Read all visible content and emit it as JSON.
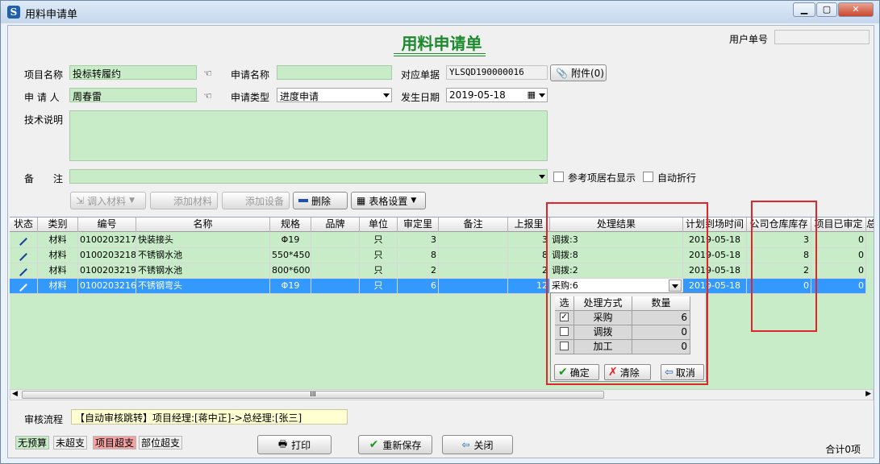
{
  "window": {
    "title": "用料申请单",
    "icon_letter": "S"
  },
  "form": {
    "title": "用料申请单",
    "user_no_label": "用户单号",
    "user_no_value": ""
  },
  "fields": {
    "project_name_label": "项目名称",
    "project_name_value": "投标转履约",
    "request_name_label": "申请名称",
    "request_name_value": "",
    "related_doc_label": "对应单据",
    "related_doc_value": "YLSQD190000016",
    "attachment_label": "附件(0)",
    "applicant_label": "申 请 人",
    "applicant_value": "周春雷",
    "request_type_label": "申请类型",
    "request_type_value": "进度申请",
    "date_label": "发生日期",
    "date_value": "2019-05-18",
    "tech_desc_label": "技术说明",
    "tech_desc_value": "",
    "remark_label": "备　　注",
    "remark_value": "",
    "ref_right_label": "参考项居右显示",
    "auto_wrap_label": "自动折行"
  },
  "toolbar": {
    "import_label": "调入材料",
    "add_material_label": "添加材料",
    "add_equipment_label": "添加设备",
    "delete_label": "删除",
    "table_settings_label": "表格设置"
  },
  "grid": {
    "columns": [
      "状态",
      "类别",
      "编号",
      "名称",
      "规格",
      "品牌",
      "单位",
      "审定里",
      "备注",
      "上报里",
      "处理结果",
      "计划到场时间",
      "公司仓库库存",
      "项目已审定",
      "总"
    ],
    "rows": [
      {
        "category": "材料",
        "code": "0100203217",
        "name": "快装接头",
        "spec": "Φ19",
        "brand": "",
        "unit": "只",
        "approved": "3",
        "note": "",
        "reported": "3",
        "result": "调拨:3",
        "plan_date": "2019-05-18",
        "stock": "3",
        "proj_approved": "0"
      },
      {
        "category": "材料",
        "code": "0100203218",
        "name": "不锈钢水池",
        "spec": "550*450*",
        "brand": "",
        "unit": "只",
        "approved": "8",
        "note": "",
        "reported": "8",
        "result": "调拨:8",
        "plan_date": "2019-05-18",
        "stock": "8",
        "proj_approved": "0"
      },
      {
        "category": "材料",
        "code": "0100203219",
        "name": "不锈钢水池",
        "spec": "800*600*",
        "brand": "",
        "unit": "只",
        "approved": "2",
        "note": "",
        "reported": "2",
        "result": "调拨:2",
        "plan_date": "2019-05-18",
        "stock": "2",
        "proj_approved": "0"
      },
      {
        "category": "材料",
        "code": "0100203216",
        "name": "不锈钢弯头",
        "spec": "Φ19",
        "brand": "",
        "unit": "只",
        "approved": "6",
        "note": "",
        "reported": "12",
        "result": "采购:6",
        "plan_date": "2019-05-18",
        "stock": "0",
        "proj_approved": "0"
      }
    ],
    "hscroll_grip": "III"
  },
  "popup": {
    "headers": [
      "选",
      "处理方式",
      "数量"
    ],
    "rows": [
      {
        "checked": true,
        "method": "采购",
        "qty": "6"
      },
      {
        "checked": false,
        "method": "调拨",
        "qty": "0"
      },
      {
        "checked": false,
        "method": "加工",
        "qty": "0"
      }
    ],
    "ok_label": "确定",
    "clear_label": "清除",
    "cancel_label": "取消"
  },
  "audit": {
    "label": "审核流程",
    "value": "【自动审核跳转】项目经理:[蒋中正]->总经理:[张三]"
  },
  "legend": {
    "no_budget": "无预算",
    "not_over": "未超支",
    "project_over": "项目超支",
    "dept_over": "部位超支"
  },
  "footer": {
    "print_label": "打印",
    "resave_label": "重新保存",
    "close_label": "关闭",
    "total_label": "合计0项"
  },
  "colors": {
    "field_green": "#c8ecc8",
    "title_green": "#1d8a2e",
    "selection_blue": "#3399ff",
    "highlight_red": "#e0262a",
    "project_over_bg": "#f4a3a3"
  }
}
